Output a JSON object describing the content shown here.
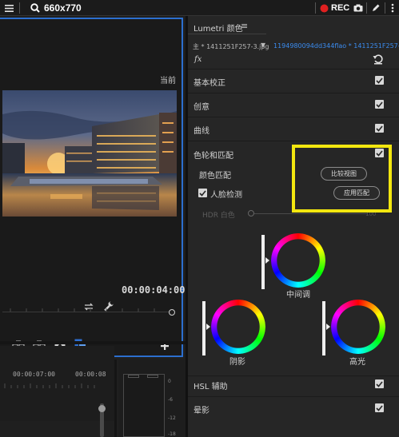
{
  "topbar": {
    "size_label": "660x770",
    "rec_label": "REC",
    "icons": [
      "menu-icon",
      "search-icon",
      "record-dot-icon",
      "camera-icon",
      "pen-icon",
      "more-icon"
    ],
    "rec_color": "#e02020"
  },
  "program": {
    "current_label": "当前",
    "timecode": "00:00:04:00",
    "accent_frame_color": "#2c6fcf"
  },
  "timeline": {
    "timecode_a": "00:00:07:00",
    "timecode_b": "00:00:08",
    "meter_scale": [
      "0",
      "-6",
      "-12",
      "-18"
    ]
  },
  "lumetri": {
    "title": "Lumetri 颜色",
    "menu_glyph": "≡",
    "clip_main": "主 * 1411251F257-3.jpg",
    "clip_seq": "1194980094dd344flao * 1411251F257-3.jpg",
    "fx_label": "fx",
    "sections": {
      "basic": "基本校正",
      "creative": "创意",
      "curves": "曲线",
      "color_wheels": "色轮和匹配",
      "hsl": "HSL 辅助",
      "vignette": "晕影"
    },
    "color_wheels": {
      "color_match_label": "颜色匹配",
      "comparison_view_button": "比较视图",
      "face_detection_label": "人脸检测",
      "apply_match_button": "应用匹配",
      "hdr_white_label": "HDR 白色",
      "hdr_value": "100",
      "midtones_label": "中间调",
      "shadows_label": "阴影",
      "highlights_label": "高光"
    },
    "highlight_color": "#f2e60f"
  }
}
